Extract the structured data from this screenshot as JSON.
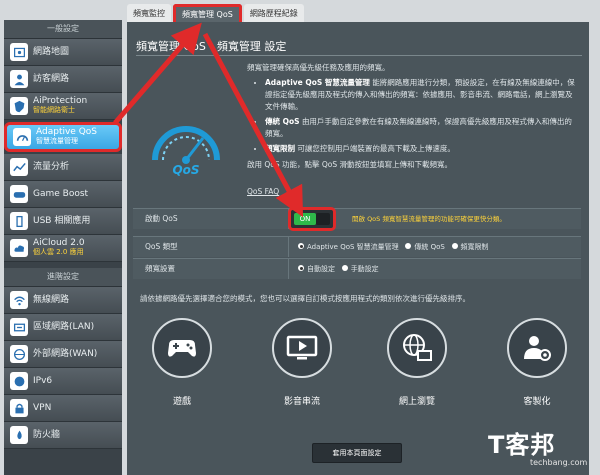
{
  "tabs": [
    {
      "label": "頻寬監控"
    },
    {
      "label": "頻寬管理 QoS"
    },
    {
      "label": "網路歷程紀錄"
    }
  ],
  "sidebar": {
    "sections": [
      {
        "header": "一般設定"
      },
      {
        "header": "進階設定"
      }
    ],
    "items": [
      {
        "label": "網路地圖",
        "icon": "map-icon"
      },
      {
        "label": "訪客網路",
        "icon": "guest-icon"
      },
      {
        "label": "AiProtection",
        "sub": "智能網路衛士",
        "icon": "shield-icon"
      },
      {
        "label": "Adaptive QoS",
        "sub": "智慧流量管理",
        "icon": "qos-icon"
      },
      {
        "label": "流量分析",
        "icon": "traffic-icon"
      },
      {
        "label": "Game Boost",
        "icon": "game-icon"
      },
      {
        "label": "USB 相關應用",
        "icon": "usb-icon"
      },
      {
        "label": "AiCloud 2.0",
        "sub": "個人雲 2.0 應用",
        "icon": "cloud-icon"
      },
      {
        "label": "無線網路",
        "icon": "wifi-icon"
      },
      {
        "label": "區域網路(LAN)",
        "icon": "lan-icon"
      },
      {
        "label": "外部網路(WAN)",
        "icon": "wan-icon"
      },
      {
        "label": "IPv6",
        "icon": "ipv6-icon"
      },
      {
        "label": "VPN",
        "icon": "vpn-icon"
      },
      {
        "label": "防火牆",
        "icon": "firewall-icon"
      }
    ]
  },
  "page": {
    "title": "頻寬管理 QoS - 頻寬管理 設定",
    "intro": "頻寬管理確保高優先級任務及應用的頻寬。",
    "bullets": [
      {
        "bold": "Adaptive QoS 智慧流量管理",
        "text": "能將網路應用進行分類，預設設定，在有線及無線連線中，保證指定優先級應用及程式的傳入和傳出的頻寬：依據應用、影音串流、網路電話，網上瀏覽及文件傳輸。"
      },
      {
        "bold": "傳統 QoS",
        "text": "由用戶手動自定參數在有線及無線連線時，保證高優先級應用及程式傳入和傳出的頻寬。"
      },
      {
        "bold": "頻寬限制",
        "text": "可讓您控制用戶端裝置的最高下載及上傳速度。"
      }
    ],
    "note": "啟用 QoS 功能，點擊 QoS 滑動按鈕並填寫上傳和下載頻寬。",
    "faq": "QoS FAQ"
  },
  "settings": {
    "enable": {
      "label": "啟動 QoS",
      "state": "ON",
      "note": "開啟 QoS 頻寬智慧流量管理的功能可確保更快分類。"
    },
    "type": {
      "label": "QoS 類型",
      "options": [
        "Adaptive QoS 智慧流量管理",
        "傳統 QoS",
        "頻寬限制"
      ],
      "selected": 0
    },
    "bandwidth": {
      "label": "頻寬設置",
      "options": [
        "自動設定",
        "手動設定"
      ],
      "selected": 0
    }
  },
  "instructions": "請依據網路優先選擇適合您的模式，您也可以選擇自訂模式按應用程式的類別依次進行優先級排序。",
  "categories": [
    {
      "label": "遊戲",
      "icon": "gamepad-icon"
    },
    {
      "label": "影音串流",
      "icon": "video-icon"
    },
    {
      "label": "網上瀏覽",
      "icon": "web-icon"
    },
    {
      "label": "客製化",
      "icon": "custom-icon"
    }
  ],
  "apply_button": "套用本頁面設定",
  "watermark": {
    "main": "T客邦",
    "site": "techbang.com"
  },
  "colors": {
    "active": "#3aa7e5",
    "highlight": "#e02a2a",
    "toggle": "#2fb84a",
    "note": "#ffd43a"
  }
}
